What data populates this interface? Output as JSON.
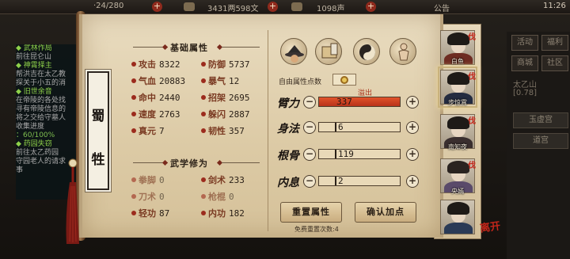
{
  "topbar": {
    "energy": "·24/280",
    "money": "3431两598文",
    "prestige": "1098声",
    "notice": "公告",
    "time": "11:26"
  },
  "quest_panel": {
    "lines": [
      {
        "text": "◆ 武林作局",
        "style": "qt"
      },
      {
        "text": "前往昆仑山",
        "style": "n"
      },
      {
        "text": "◆ 神霄择主",
        "style": "qt"
      },
      {
        "text": "帮洪吉在太乙教",
        "style": "n"
      },
      {
        "text": "探关于小五的消",
        "style": "n"
      },
      {
        "text": "◆ 旧世余音",
        "style": "qt"
      },
      {
        "text": "在帝陵的各处找",
        "style": "n"
      },
      {
        "text": "寻有帝陵信息的",
        "style": "n"
      },
      {
        "text": "将之交给守墓人",
        "style": "n"
      },
      {
        "text": "收集进度",
        "style": "n"
      },
      {
        "text": "：60/100%",
        "style": "qg"
      },
      {
        "text": "◆ 药园失窃",
        "style": "qt"
      },
      {
        "text": "前往太乙药园",
        "style": "n"
      },
      {
        "text": "守园老人的请求",
        "style": "n"
      },
      {
        "text": "事",
        "style": "n"
      }
    ]
  },
  "character": {
    "name_char1": "蜀",
    "name_char2": "牲"
  },
  "basic_attributes": {
    "title": "基础属性",
    "left": [
      {
        "label": "攻击",
        "value": "8322"
      },
      {
        "label": "气血",
        "value": "20883"
      },
      {
        "label": "命中",
        "value": "2440"
      },
      {
        "label": "速度",
        "value": "2763"
      },
      {
        "label": "真元",
        "value": "7"
      }
    ],
    "right": [
      {
        "label": "防御",
        "value": "5737"
      },
      {
        "label": "暴气",
        "value": "12"
      },
      {
        "label": "招架",
        "value": "2695"
      },
      {
        "label": "躲闪",
        "value": "2887"
      },
      {
        "label": "韧性",
        "value": "357"
      }
    ]
  },
  "martial_arts": {
    "title": "武学修为",
    "left": [
      {
        "label": "拳脚",
        "value": "0"
      },
      {
        "label": "刀术",
        "value": "0"
      },
      {
        "label": "轻功",
        "value": "87"
      }
    ],
    "right": [
      {
        "label": "剑术",
        "value": "233"
      },
      {
        "label": "枪棍",
        "value": "0"
      },
      {
        "label": "内功",
        "value": "182"
      }
    ]
  },
  "free_points_label": "自由属性点数",
  "overflow_label": "溢出",
  "allocation": [
    {
      "label": "臂力",
      "value": "337",
      "fill": 1.0,
      "color": "#c83a1e"
    },
    {
      "label": "身法",
      "value": "6",
      "fill": 0.0,
      "color": "#c83a1e"
    },
    {
      "label": "根骨",
      "value": "119",
      "fill": 0.0,
      "color": "#c83a1e"
    },
    {
      "label": "内息",
      "value": "2",
      "fill": 0.0,
      "color": "#c83a1e"
    }
  ],
  "buttons": {
    "reset": "重置属性",
    "confirm": "确认加点",
    "free_reset_note": "免费重置次数:4"
  },
  "party": [
    {
      "name": "白鱼",
      "badge": "伐"
    },
    {
      "name": "步惊霄",
      "badge": "伐"
    },
    {
      "name": "南知夜",
      "badge": "伐"
    },
    {
      "name": "央嫣",
      "badge": "伐"
    },
    {
      "name": "",
      "badge": ""
    }
  ],
  "right_menu": {
    "btn1": "活动",
    "btn2": "福利",
    "btn3": "商城",
    "btn4": "社区",
    "location": "太乙山",
    "coords": "[0.78]",
    "tab1": "玉虚宫",
    "tab2": "道宫"
  },
  "seal": "离开"
}
